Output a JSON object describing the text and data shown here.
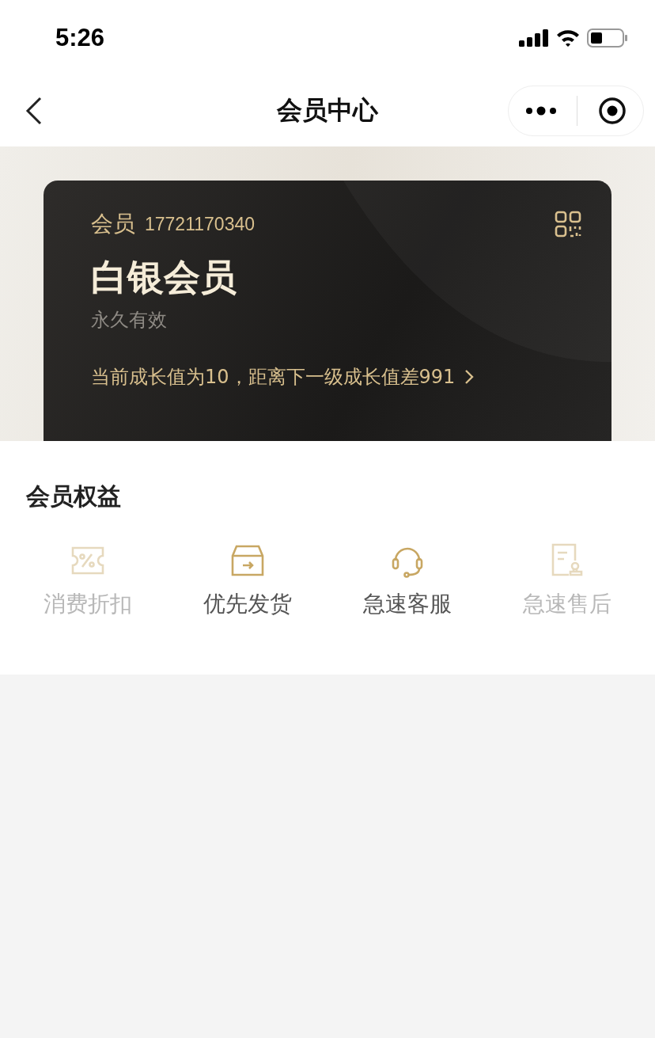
{
  "status_bar": {
    "time": "5:26"
  },
  "nav": {
    "title": "会员中心"
  },
  "card": {
    "label": "会员",
    "phone": "17721170340",
    "level_name": "白银会员",
    "validity": "永久有效",
    "growth": "当前成长值为10，距离下一级成长值差991"
  },
  "benefits": {
    "title": "会员权益",
    "items": [
      {
        "kind": "discount",
        "label": "消费折扣",
        "disabled": true
      },
      {
        "kind": "shipping",
        "label": "优先发货",
        "disabled": false
      },
      {
        "kind": "service",
        "label": "急速客服",
        "disabled": false
      },
      {
        "kind": "aftersale",
        "label": "急速售后",
        "disabled": true
      }
    ]
  }
}
